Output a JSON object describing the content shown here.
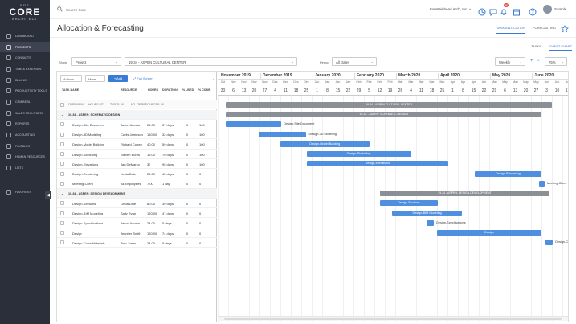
{
  "brand": {
    "line1": "RDE",
    "line2": "CORE",
    "line3": "ARCHITECT"
  },
  "sidebar": {
    "items": [
      {
        "label": "Dashboard",
        "icon": "dashboard-icon"
      },
      {
        "label": "Projects",
        "icon": "projects-icon"
      },
      {
        "label": "Contacts",
        "icon": "contacts-icon"
      },
      {
        "label": "Time & Expenses",
        "icon": "time-icon"
      },
      {
        "label": "Billing",
        "icon": "billing-icon"
      },
      {
        "label": "Productivity Tools",
        "icon": "tools-icon"
      },
      {
        "label": "CRM BETA",
        "icon": "crm-icon"
      },
      {
        "label": "Sales Tools BETA",
        "icon": "sales-icon"
      },
      {
        "label": "Reports",
        "icon": "reports-icon"
      },
      {
        "label": "Accounting",
        "icon": "accounting-icon"
      },
      {
        "label": "Payables",
        "icon": "payables-icon"
      },
      {
        "label": "Human Resources",
        "icon": "hr-icon"
      },
      {
        "label": "Lists",
        "icon": "lists-icon"
      },
      {
        "label": "Favorites",
        "icon": "favorites-icon"
      }
    ],
    "collapse": "◀"
  },
  "topbar": {
    "search_placeholder": "Search Core",
    "company": "Fountainhead Arch, Inc.",
    "notification_count": "12",
    "user": "Sample"
  },
  "page": {
    "title": "Allocation & Forecasting",
    "tabs": [
      "TASK ALLOCATION",
      "FORECASTING"
    ],
    "view_tabs": [
      "TASKS",
      "GANTT CHART"
    ]
  },
  "filters": {
    "show_label": "Show",
    "show_value": "Project",
    "project_value": "19-34 - ASPEN CULTURAL CENTER",
    "period_label": "Period",
    "period_value": "All Dates",
    "scale_value": "Weekly",
    "zoom_value": "75%"
  },
  "toolbar": {
    "actions": "Actions",
    "more": "More",
    "add": "+ Add",
    "full_screen": "Full Screen"
  },
  "columns": [
    "Task Name",
    "Resource",
    "Hours",
    "Duration",
    "% Used",
    "% Comp."
  ],
  "overview": {
    "label": "OVERVIEW",
    "hours": "HOURS: 671",
    "tasks": "TASKS: 10",
    "resources": "NO. OF RESOURCES: 10"
  },
  "rows": [
    {
      "type": "summary",
      "name": "19-34 - ASPEN: SCHEMATIC DESIGN"
    },
    {
      "type": "task",
      "name": "Design-Site Document",
      "resource": "Jason Acosta",
      "hours": "24.00",
      "duration": "37 days",
      "used": "0",
      "comp": "100"
    },
    {
      "type": "task",
      "name": "Design-3D Modeling",
      "resource": "Curtis Jameson",
      "hours": "160.00",
      "duration": "32 days",
      "used": "0",
      "comp": "100"
    },
    {
      "type": "task",
      "name": "Design-Model Building",
      "resource": "Richard Cohen",
      "hours": "40.00",
      "duration": "59 days",
      "used": "0",
      "comp": "100"
    },
    {
      "type": "task",
      "name": "Design-Sketching",
      "resource": "Steven Burns",
      "hours": "16.00",
      "duration": "70 days",
      "used": "0",
      "comp": "100"
    },
    {
      "type": "task",
      "name": "Design-Elevations",
      "resource": "Jan DeMarco",
      "hours": "32",
      "duration": "95 days",
      "used": "0",
      "comp": "100"
    },
    {
      "type": "task",
      "name": "Design-Rendering",
      "resource": "Linda Dale",
      "hours": "24.00",
      "duration": "45 days",
      "used": "0",
      "comp": "0"
    },
    {
      "type": "task",
      "name": "Meeting-Client",
      "resource": "All Employees",
      "hours": "7.00",
      "duration": "1 day",
      "used": "0",
      "comp": "0"
    },
    {
      "type": "summary",
      "name": "19-34 - ASPEN: DESIGN DEVELOPMENT"
    },
    {
      "type": "task",
      "name": "Design-Sections",
      "resource": "Linda Dale",
      "hours": "80.00",
      "duration": "39 days",
      "used": "0",
      "comp": "0"
    },
    {
      "type": "task",
      "name": "Design-BIM Modeling",
      "resource": "Sally Ryan",
      "hours": "120.00",
      "duration": "47 days",
      "used": "0",
      "comp": "0"
    },
    {
      "type": "task",
      "name": "Design-Specifications",
      "resource": "Jason Acosta",
      "hours": "24.00",
      "duration": "5 days",
      "used": "0",
      "comp": "0"
    },
    {
      "type": "task",
      "name": "Design",
      "resource": "Jennifer Smith",
      "hours": "120.00",
      "duration": "74 days",
      "used": "0",
      "comp": "0"
    },
    {
      "type": "task",
      "name": "Design-Color/Materials",
      "resource": "Tom Jones",
      "hours": "24.00",
      "duration": "5 days",
      "used": "0",
      "comp": "0"
    }
  ],
  "timeline": {
    "months": [
      {
        "label": "November 2019",
        "col": 0
      },
      {
        "label": "December 2019",
        "col": 4
      },
      {
        "label": "January 2020",
        "col": 9
      },
      {
        "label": "February 2020",
        "col": 13
      },
      {
        "label": "March 2020",
        "col": 17
      },
      {
        "label": "April 2020",
        "col": 21
      },
      {
        "label": "May 2020",
        "col": 26
      },
      {
        "label": "June 2020",
        "col": 30
      }
    ],
    "weeks": [
      {
        "m": "Oct",
        "d": "30"
      },
      {
        "m": "Nov",
        "d": "6"
      },
      {
        "m": "Nov",
        "d": "13"
      },
      {
        "m": "Nov",
        "d": "20"
      },
      {
        "m": "Nov",
        "d": "27"
      },
      {
        "m": "Dec",
        "d": "4"
      },
      {
        "m": "Dec",
        "d": "11"
      },
      {
        "m": "Dec",
        "d": "18"
      },
      {
        "m": "Dec",
        "d": "25"
      },
      {
        "m": "Jan",
        "d": "1"
      },
      {
        "m": "Jan",
        "d": "8"
      },
      {
        "m": "Jan",
        "d": "15"
      },
      {
        "m": "Jan",
        "d": "22"
      },
      {
        "m": "Feb",
        "d": "29"
      },
      {
        "m": "Feb",
        "d": "5"
      },
      {
        "m": "Feb",
        "d": "12"
      },
      {
        "m": "Feb",
        "d": "19"
      },
      {
        "m": "Mar",
        "d": "26"
      },
      {
        "m": "Mar",
        "d": "4"
      },
      {
        "m": "Mar",
        "d": "11"
      },
      {
        "m": "Mar",
        "d": "18"
      },
      {
        "m": "Mar",
        "d": "25"
      },
      {
        "m": "Apr",
        "d": "1"
      },
      {
        "m": "Apr",
        "d": "8"
      },
      {
        "m": "Apr",
        "d": "15"
      },
      {
        "m": "Apr",
        "d": "22"
      },
      {
        "m": "May",
        "d": "29"
      },
      {
        "m": "May",
        "d": "6"
      },
      {
        "m": "May",
        "d": "13"
      },
      {
        "m": "May",
        "d": "20"
      },
      {
        "m": "May",
        "d": "27"
      },
      {
        "m": "Jun",
        "d": "3"
      },
      {
        "m": "Jun",
        "d": "10"
      },
      {
        "m": "Jun",
        "d": "17"
      }
    ],
    "bars": [
      {
        "row": -1,
        "start": 0.8,
        "span": 31.2,
        "label": "19-34 - ASPEN CULTURAL CENTER",
        "kind": "summary"
      },
      {
        "row": 0,
        "start": 0.8,
        "span": 30.2,
        "label": "19-34 - ASPEN: Schematic Design",
        "kind": "summary"
      },
      {
        "row": 1,
        "start": 0.8,
        "span": 5.3,
        "label": "Design-Site Document",
        "kind": "task",
        "outside": true
      },
      {
        "row": 2,
        "start": 3.9,
        "span": 4.6,
        "label": "Design-3D Modeling",
        "kind": "task",
        "outside": true
      },
      {
        "row": 3,
        "start": 6.0,
        "span": 8.5,
        "label": "Design-Model Building",
        "kind": "task"
      },
      {
        "row": 4,
        "start": 8.5,
        "span": 10.0,
        "label": "Design-Sketching",
        "kind": "task"
      },
      {
        "row": 5,
        "start": 8.5,
        "span": 13.6,
        "label": "Design-Elevations",
        "kind": "task"
      },
      {
        "row": 6,
        "start": 24.6,
        "span": 6.4,
        "label": "Design-Rendering",
        "kind": "task"
      },
      {
        "row": 7,
        "start": 30.8,
        "span": 0.5,
        "label": "Meeting-Client",
        "kind": "task",
        "outside": true
      },
      {
        "row": 8,
        "start": 15.5,
        "span": 16.3,
        "label": "19-34 - ASPEN: Design Development",
        "kind": "summary"
      },
      {
        "row": 9,
        "start": 15.5,
        "span": 5.6,
        "label": "Design-Sections",
        "kind": "task"
      },
      {
        "row": 10,
        "start": 16.7,
        "span": 6.7,
        "label": "Design-BIM Modeling",
        "kind": "task"
      },
      {
        "row": 11,
        "start": 20.0,
        "span": 0.7,
        "label": "Design-Specifications",
        "kind": "task",
        "outside": true
      },
      {
        "row": 12,
        "start": 21.0,
        "span": 10.0,
        "label": "Design",
        "kind": "task"
      },
      {
        "row": 13,
        "start": 31.4,
        "span": 0.7,
        "label": "Design-Color/Mate",
        "kind": "task",
        "outside": true
      }
    ]
  },
  "colors": {
    "accent": "#3a7bd5",
    "sidebar": "#2b2f3a",
    "task_bar": "#4f8fe0",
    "summary_bar": "#8b8f96"
  }
}
